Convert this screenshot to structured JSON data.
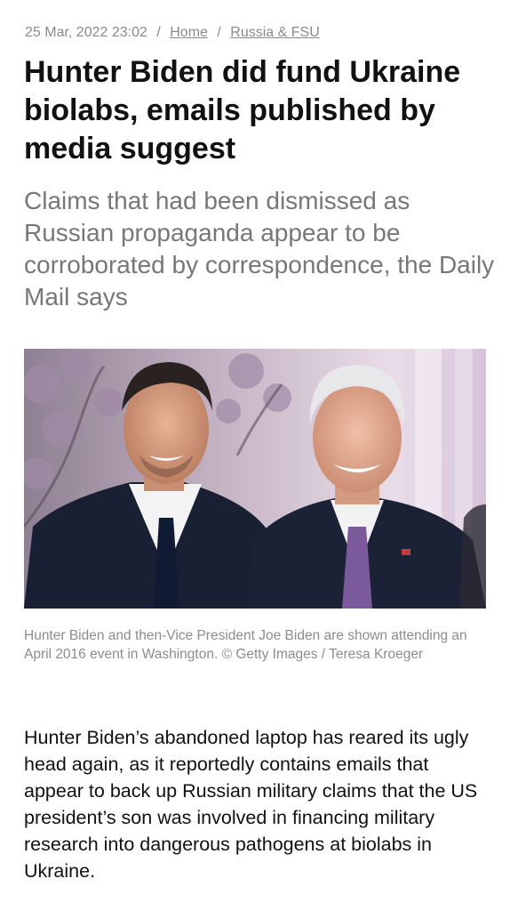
{
  "meta": {
    "date": "25 Mar, 2022 23:02",
    "separator": "/",
    "breadcrumb": [
      "Home",
      "Russia & FSU"
    ]
  },
  "article": {
    "headline": "Hunter Biden did fund Ukraine biolabs, emails published by media suggest",
    "subheadline": "Claims that had been dismissed as Russian propaganda appear to be corroborated by correspondence, the Daily Mail says",
    "image_caption": "Hunter Biden and then-Vice President Joe Biden are shown attending an April 2016 event in Washington. © Getty Images / Teresa Kroeger",
    "body": "Hunter Biden’s abandoned laptop has reared its ugly head again, as it reportedly contains emails that appear to back up Russian military claims that the US president’s son was involved in financing military research into dangerous pathogens at biolabs in Ukraine."
  },
  "colors": {
    "meta_text": "#8a8a8a",
    "headline": "#111111",
    "subheadline": "#777777",
    "caption": "#8c8c8c",
    "body": "#111111"
  }
}
